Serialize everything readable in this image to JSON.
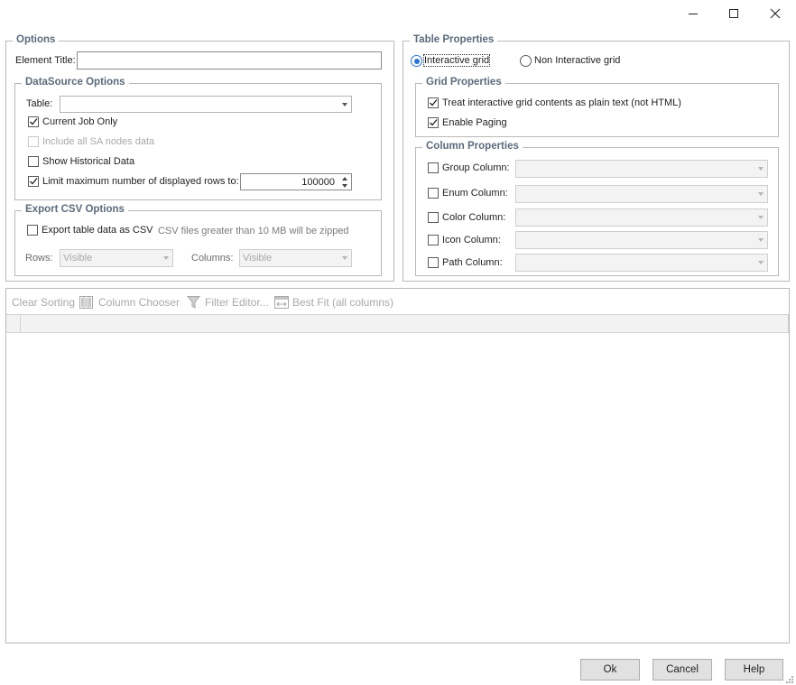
{
  "window_controls": {
    "minimize": "minimize",
    "maximize": "maximize",
    "close": "close"
  },
  "options": {
    "group_title": "Options",
    "element_title_label": "Element Title:",
    "element_title_value": ""
  },
  "datasource": {
    "group_title": "DataSource Options",
    "table_label": "Table:",
    "table_value": "",
    "current_job_only": {
      "label": "Current Job Only",
      "checked": true
    },
    "include_all_sa": {
      "label": "Include all SA nodes data",
      "checked": false,
      "enabled": false
    },
    "show_historical": {
      "label": "Show Historical Data",
      "checked": false
    },
    "limit_rows": {
      "label": "Limit maximum number of displayed rows to:",
      "checked": true,
      "value": "100000"
    }
  },
  "export_csv": {
    "group_title": "Export CSV Options",
    "export_label": "Export table data as CSV",
    "export_note": "CSV files greater than 10 MB will be zipped",
    "rows_label": "Rows:",
    "rows_value": "Visible",
    "columns_label": "Columns:",
    "columns_value": "Visible"
  },
  "table_properties": {
    "group_title": "Table Properties",
    "interactive_label": "Interactive grid",
    "non_interactive_label": "Non Interactive grid",
    "selected": "interactive"
  },
  "grid_properties": {
    "group_title": "Grid Properties",
    "plain_text": {
      "label": "Treat interactive grid contents as plain text (not HTML)",
      "checked": true
    },
    "enable_paging": {
      "label": "Enable Paging",
      "checked": true
    }
  },
  "column_properties": {
    "group_title": "Column Properties",
    "rows": [
      {
        "label": "Group Column:",
        "value": ""
      },
      {
        "label": "Enum Column:",
        "value": ""
      },
      {
        "label": "Color Column:",
        "value": ""
      },
      {
        "label": "Icon Column:",
        "value": ""
      },
      {
        "label": "Path Column:",
        "value": ""
      }
    ]
  },
  "toolbar": {
    "clear_sorting": "Clear Sorting",
    "column_chooser": "Column Chooser",
    "filter_editor": "Filter Editor...",
    "best_fit": "Best Fit (all columns)"
  },
  "buttons": {
    "ok": "Ok",
    "cancel": "Cancel",
    "help": "Help"
  },
  "colors": {
    "accent": "#2a74d4",
    "group_title": "#5b6b7b",
    "disabled": "#a9a9a9"
  }
}
